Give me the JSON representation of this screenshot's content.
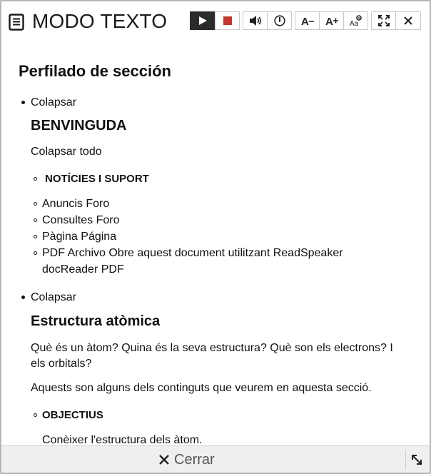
{
  "header": {
    "title": "MODO TEXTO",
    "icons": [
      "text-mode-icon",
      "play-icon",
      "stop-icon",
      "volume-icon",
      "speed-icon",
      "decrease-font-icon",
      "increase-font-icon",
      "text-settings-icon",
      "fullscreen-icon",
      "close-icon"
    ],
    "colors": {
      "play_bg": "#2b2b2b",
      "stop": "#c0392b"
    }
  },
  "content": {
    "main_heading": "Perfilado de sección",
    "sections": [
      {
        "collapse_label": "Colapsar",
        "heading": "BENVINGUDA",
        "collapse_all_label": "Colapsar todo",
        "subheading": "NOTÍCIES I SUPORT",
        "items": [
          "Anuncis Foro",
          "Consultes Foro",
          "Pàgina Página",
          "PDF Archivo Obre aquest document utilitzant ReadSpeaker",
          "docReader PDF"
        ]
      },
      {
        "collapse_label": "Colapsar",
        "heading": "Estructura atòmica",
        "paragraph_line1": " Què és un àtom? Quina és la seva estructura? Què son els electrons? I",
        "paragraph_line2": "els orbitals?",
        "paragraph2": "Aquests son alguns dels continguts que veurem en aquesta secció.",
        "subheading": "OBJECTIUS",
        "objective": "Conèixer l'estructura dels àtom."
      }
    ]
  },
  "footer": {
    "close_label": "Cerrar"
  }
}
